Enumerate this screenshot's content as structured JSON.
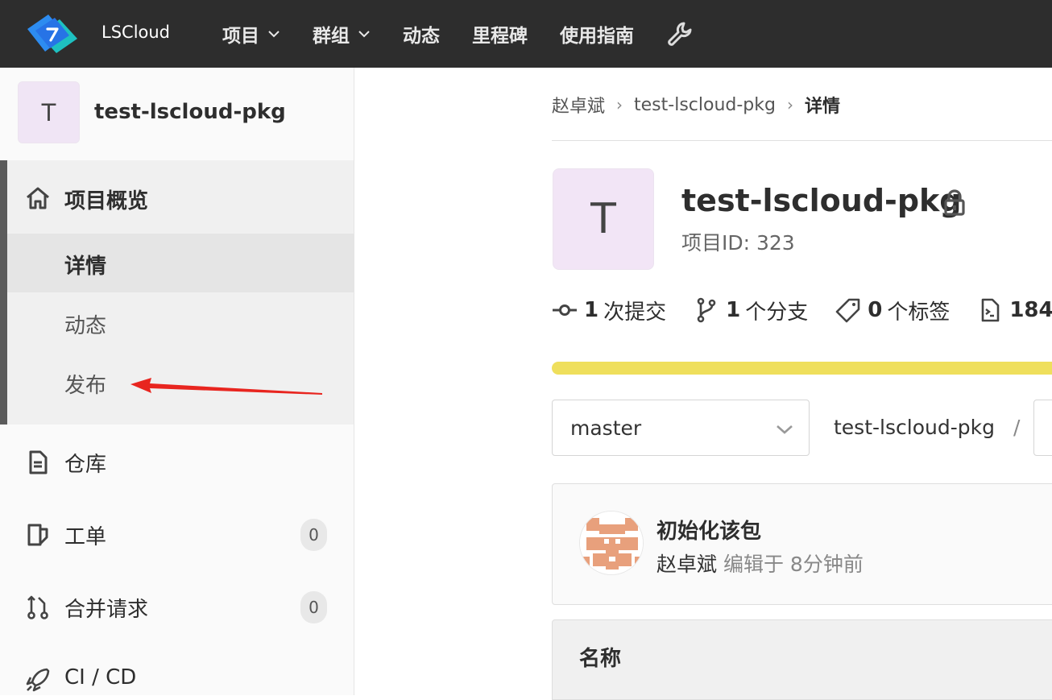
{
  "navbar": {
    "brand": "LSCloud",
    "items": [
      {
        "label": "项目",
        "dropdown": true
      },
      {
        "label": "群组",
        "dropdown": true
      },
      {
        "label": "动态",
        "dropdown": false
      },
      {
        "label": "里程碑",
        "dropdown": false
      },
      {
        "label": "使用指南",
        "dropdown": false
      }
    ],
    "wrench_icon": "wrench-icon"
  },
  "sidebar": {
    "project_initial": "T",
    "project_name": "test-lscloud-pkg",
    "overview": {
      "label": "项目概览",
      "icon": "home-icon",
      "subitems": [
        "详情",
        "动态",
        "发布"
      ],
      "active_subitem": "详情"
    },
    "items": [
      {
        "label": "仓库",
        "icon": "document-icon"
      },
      {
        "label": "工单",
        "icon": "issues-icon",
        "count": "0"
      },
      {
        "label": "合并请求",
        "icon": "merge-request-icon",
        "count": "0"
      },
      {
        "label": "CI / CD",
        "icon": "rocket-icon"
      }
    ]
  },
  "breadcrumb": {
    "items": [
      "赵卓斌",
      "test-lscloud-pkg"
    ],
    "current": "详情"
  },
  "project": {
    "initial": "T",
    "title": "test-lscloud-pkg",
    "id_text": "项目ID: 323",
    "stats": [
      {
        "icon": "commit-icon",
        "count": "1",
        "label": "次提交"
      },
      {
        "icon": "branch-icon",
        "count": "1",
        "label": "个分支"
      },
      {
        "icon": "tag-icon",
        "count": "0",
        "label": "个标签"
      },
      {
        "icon": "file-icon",
        "count": "184",
        "label": ""
      }
    ],
    "language_bar_color": "#efdf5c"
  },
  "repo": {
    "branch": "master",
    "path_root": "test-lscloud-pkg",
    "path_sep": "/"
  },
  "commit": {
    "title": "初始化该包",
    "author": "赵卓斌",
    "meta": "编辑于 8分钟前",
    "avatar_color": "#e8a07c"
  },
  "file_table": {
    "header_name": "名称"
  },
  "colors": {
    "navbar_bg": "#2d2d2d",
    "annotation_arrow": "#e8251f"
  }
}
